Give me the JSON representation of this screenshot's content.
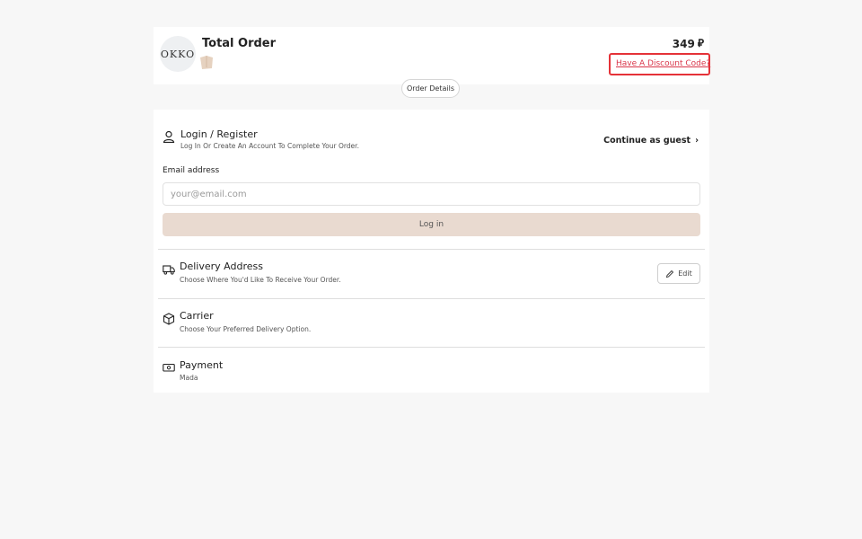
{
  "summary": {
    "logo_text": "OKKO",
    "title": "Total Order",
    "total": "349",
    "currency_symbol": "⃁",
    "discount_link": "Have A Discount Code?",
    "details_button": "Order Details"
  },
  "login": {
    "title": "Login / Register",
    "subtitle": "Log In Or Create An Account To Complete Your Order.",
    "guest_link": "Continue as guest",
    "guest_chevron": "›",
    "email_label": "Email address",
    "email_placeholder": "your@email.com",
    "email_value": "",
    "login_button": "Log in"
  },
  "delivery": {
    "title": "Delivery Address",
    "subtitle": "Choose Where You'd Like To Receive Your Order.",
    "edit_button": "Edit"
  },
  "carrier": {
    "title": "Carrier",
    "subtitle": "Choose Your Preferred Delivery Option."
  },
  "payment": {
    "title": "Payment",
    "subtitle": "Mada"
  },
  "colors": {
    "highlight": "#e53238",
    "discount_text": "#d9364a",
    "login_button_bg": "#e9dad0"
  },
  "icons": [
    "user-icon",
    "truck-icon",
    "box-icon",
    "cash-icon",
    "pencil-icon",
    "chevron-right-icon"
  ]
}
